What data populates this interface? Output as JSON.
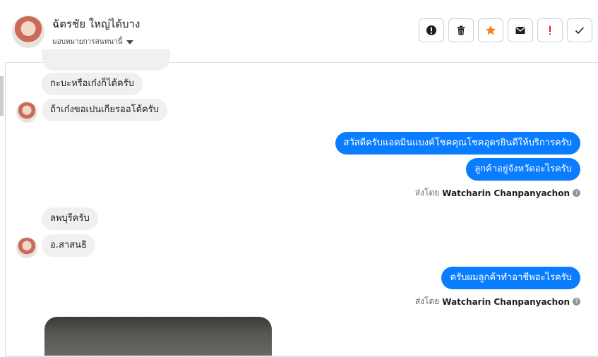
{
  "header": {
    "contact_name": "ฉัตรชัย ใหญ่ได้บาง",
    "assign_label": "มอบหมายการสนทนานี้",
    "actions": [
      {
        "icon": "alert-circle-icon",
        "color": "#1c1e21"
      },
      {
        "icon": "trash-icon",
        "color": "#1c1e21"
      },
      {
        "icon": "star-icon",
        "color": "#f5821f"
      },
      {
        "icon": "envelope-icon",
        "color": "#1c1e21"
      },
      {
        "icon": "exclamation-icon",
        "color": "#e02020"
      },
      {
        "icon": "check-icon",
        "color": "#1c1e21"
      }
    ]
  },
  "messages": {
    "in_1": "กะบะหรือเก๋งก็ได้ครับ",
    "in_2": "ถ้าเก๋งขอเปนเกียรออโต้ครับ",
    "out_1": "สวัสดีครับแอดมินแบงค์โชคคุณโชคอุดรยินดีให้บริการครับ",
    "out_2": "ลูกค้าอยู่จังหวัดอะไรครับ",
    "in_3": "ลพบุรีครับ",
    "in_4": "อ.สาสนธิ",
    "out_3": "ครับผมลูกค้าทำอาชีพอะไรครับ"
  },
  "sent_by": {
    "prefix": "ส่งโดย",
    "name": "Watcharin Chanpanyachon",
    "help": "?"
  },
  "colors": {
    "outgoing_bubble": "#0a7cff",
    "incoming_bubble": "#f0f0f0"
  }
}
